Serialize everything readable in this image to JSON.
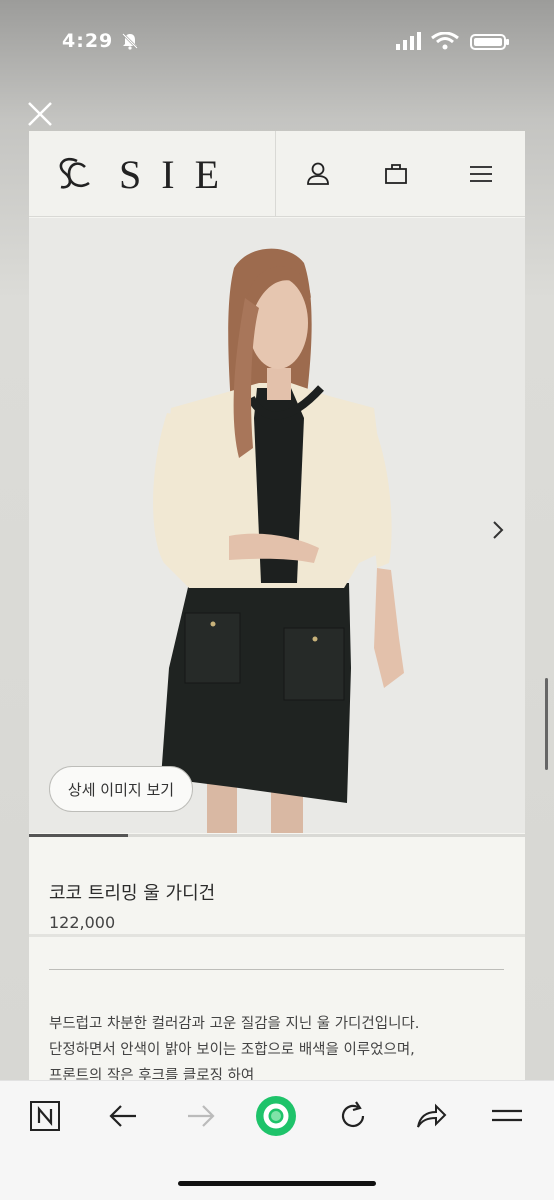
{
  "status_bar": {
    "time": "4:29",
    "network": "LTE"
  },
  "header": {
    "logo_text": "SIE"
  },
  "hero": {
    "detail_button_label": "상세 이미지 보기",
    "image_progress": 0.2
  },
  "product": {
    "name": "코코 트리밍 울 가디건",
    "price": "122,000",
    "description": [
      "부드럽고 차분한 컬러감과 고운 질감을 지닌 울 가디건입니다.",
      "단정하면서 안색이 밝아 보이는 조합으로 배색을 이루었으며,",
      "프론트의 작은 후크를 클로징 하여"
    ]
  },
  "icons": {
    "close": "close-icon",
    "user": "user-icon",
    "bag": "shopping-bag-icon",
    "menu": "hamburger-menu-icon",
    "next": "chevron-right-icon",
    "naver": "naver-n-icon",
    "back": "arrow-left-icon",
    "forward": "arrow-right-icon",
    "home": "green-home-icon",
    "refresh": "refresh-icon",
    "share": "share-icon",
    "more": "more-menu-icon"
  },
  "colors": {
    "accent_green": "#1ec36a",
    "page_bg": "#f5f5f1"
  }
}
